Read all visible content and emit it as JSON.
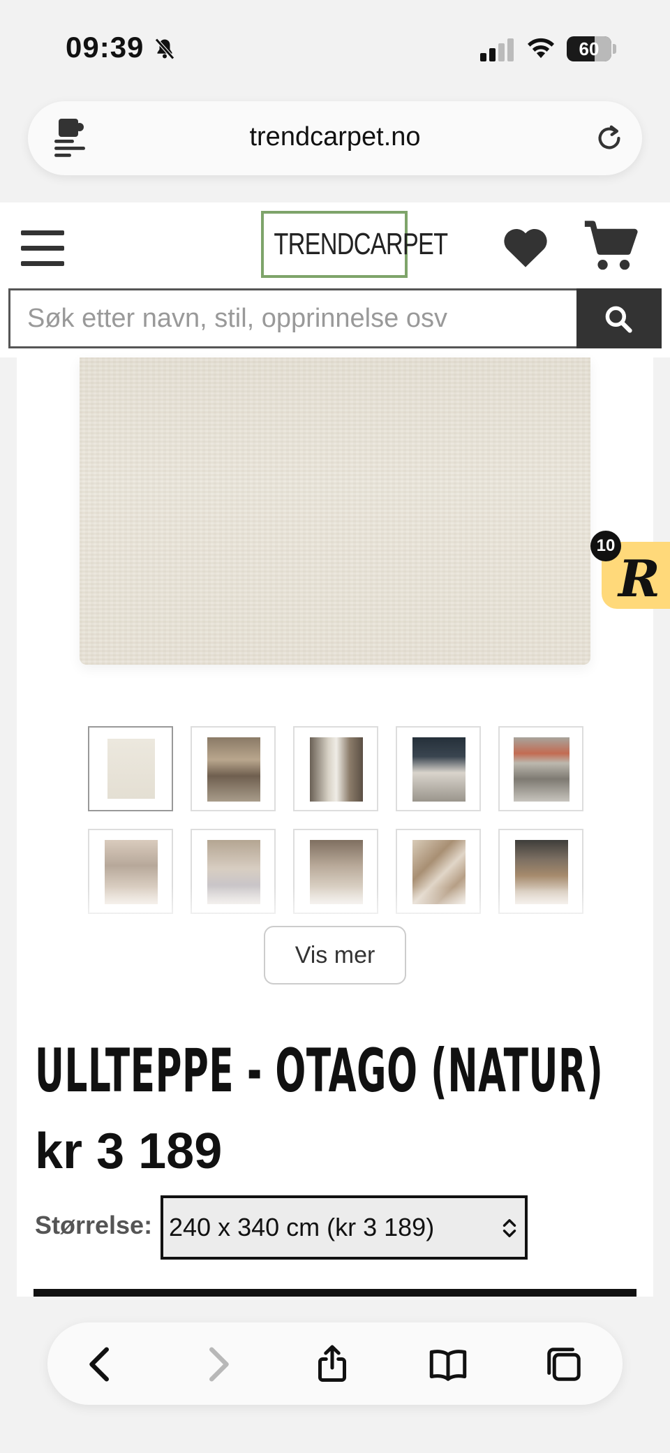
{
  "status_bar": {
    "time": "09:39",
    "battery": "60",
    "icons": [
      "bell-slash-icon",
      "signal-icon",
      "wifi-icon",
      "battery-icon"
    ]
  },
  "browser": {
    "url": "trendcarpet.no",
    "icons": [
      "extension-icon",
      "reload-icon"
    ]
  },
  "header": {
    "logo": "TRENDCARPET",
    "icons": [
      "menu-icon",
      "heart-icon",
      "cart-icon",
      "search-icon"
    ],
    "colors": {
      "logo_border": "#7ea46a",
      "search_button": "#333333"
    }
  },
  "search": {
    "placeholder": "Søk etter navn, stil, opprinnelse osv"
  },
  "gallery": {
    "thumbnails": [
      {
        "subject": "rug",
        "active": true
      },
      {
        "subject": "living-room"
      },
      {
        "subject": "living-room"
      },
      {
        "subject": "living-room"
      },
      {
        "subject": "living-room"
      },
      {
        "subject": "living-room"
      },
      {
        "subject": "living-room"
      },
      {
        "subject": "living-room"
      },
      {
        "subject": "rug-closeup"
      },
      {
        "subject": "dining-room"
      }
    ],
    "show_more_label": "Vis mer"
  },
  "product": {
    "title": "ULLTEPPE - OTAGO (NATUR)",
    "price": "kr 3 189",
    "size_label": "Størrelse:",
    "size_selected": "240 x 340 cm (kr 3 189)"
  },
  "badge": {
    "letter": "R",
    "count": "10",
    "color": "#ffd97a"
  },
  "toolbar": {
    "icons": [
      "back-icon",
      "forward-icon",
      "share-icon",
      "bookmarks-icon",
      "tabs-icon"
    ]
  }
}
